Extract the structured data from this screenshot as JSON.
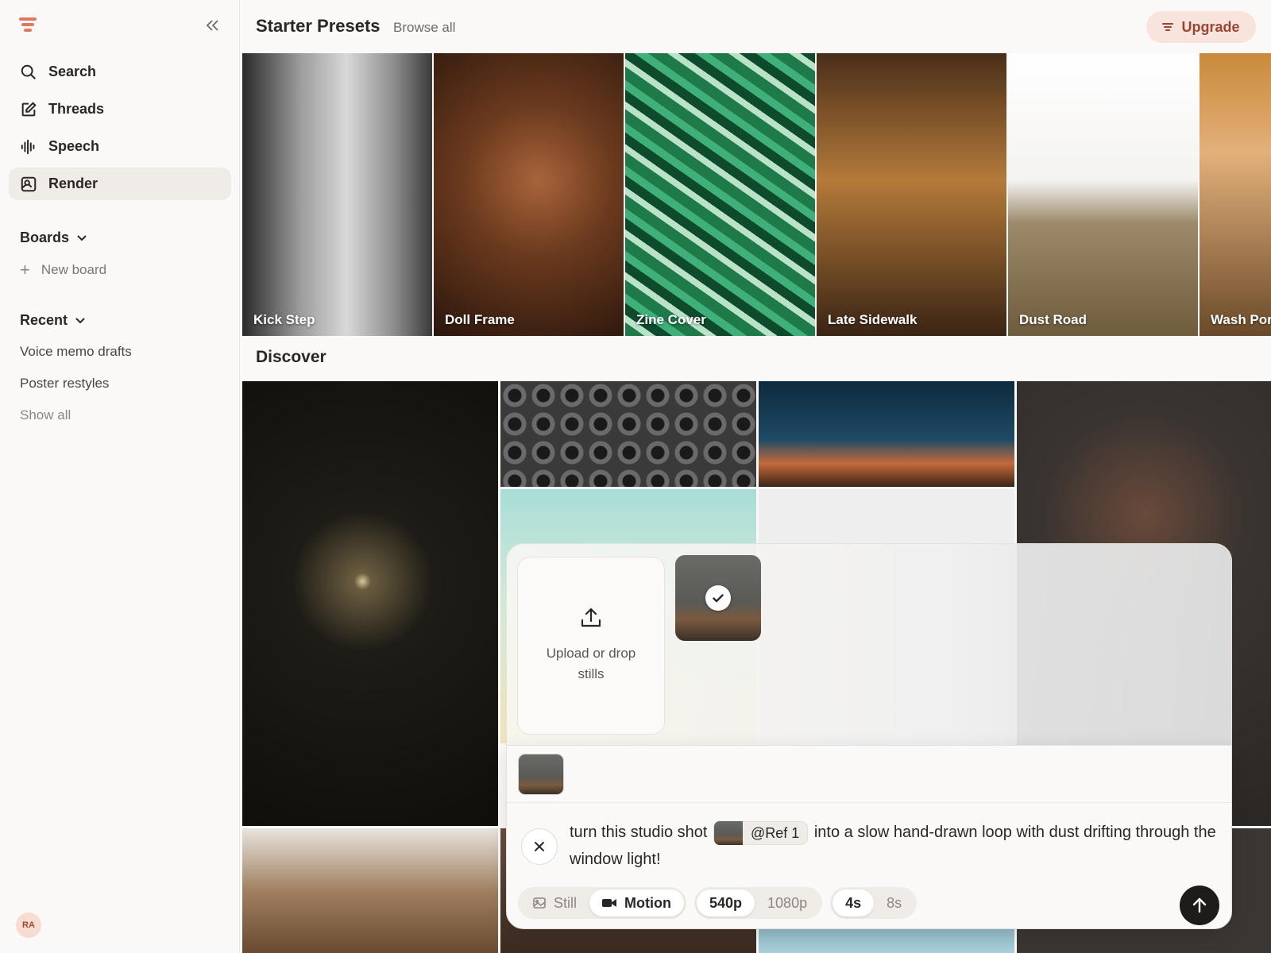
{
  "sidebar": {
    "nav": [
      {
        "label": "Search",
        "icon": "search-icon"
      },
      {
        "label": "Threads",
        "icon": "compose-icon"
      },
      {
        "label": "Speech",
        "icon": "waveform-icon"
      },
      {
        "label": "Render",
        "icon": "image-search-icon",
        "active": true
      }
    ],
    "boards_label": "Boards",
    "new_board_label": "New board",
    "recent_label": "Recent",
    "recent_items": [
      "Voice memo drafts",
      "Poster restyles"
    ],
    "show_all_label": "Show all",
    "avatar_initials": "RA"
  },
  "header": {
    "title": "Starter Presets",
    "browse_all": "Browse all",
    "upgrade_label": "Upgrade"
  },
  "presets": [
    "Kick Step",
    "Doll Frame",
    "Zine Cover",
    "Late Sidewalk",
    "Dust Road",
    "Wash Port"
  ],
  "discover_title": "Discover",
  "composer": {
    "upload_text": "Upload or drop stills",
    "prompt_before": "turn this studio shot",
    "ref_label": "@Ref 1",
    "prompt_after": "into a slow hand-drawn loop with dust drifting through the window light!",
    "mode_options": [
      "Still",
      "Motion"
    ],
    "mode_selected": "Motion",
    "resolution_options": [
      "540p",
      "1080p"
    ],
    "resolution_selected": "540p",
    "duration_options": [
      "4s",
      "8s"
    ],
    "duration_selected": "4s"
  },
  "colors": {
    "accent": "#e07a5f",
    "upgrade_bg": "#f8e4dc",
    "upgrade_text": "#9a4530",
    "send_button": "#1e1c1b"
  }
}
